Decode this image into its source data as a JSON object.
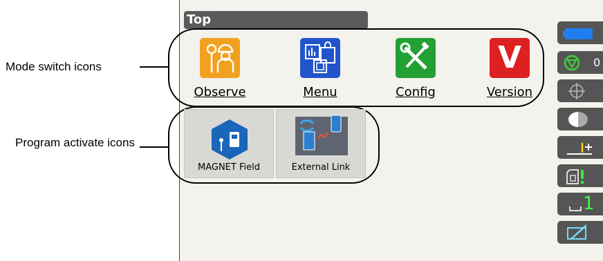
{
  "annotations": {
    "mode_switch": "Mode switch icons",
    "program_activate": "Program activate icons"
  },
  "screen": {
    "title": "Top",
    "mode_icons": [
      {
        "label": "Observe",
        "icon": "surveyor-icon",
        "color": "#f2a020"
      },
      {
        "label": "Menu",
        "icon": "menu-icon",
        "color": "#2255cc"
      },
      {
        "label": "Config",
        "icon": "wrench-screwdriver-icon",
        "color": "#22a033"
      },
      {
        "label": "Version",
        "icon": "version-v-icon",
        "color": "#dd2020",
        "glyph": "V"
      }
    ],
    "program_icons": [
      {
        "label": "MAGNET Field",
        "icon": "magnet-field-icon"
      },
      {
        "label": "External Link",
        "icon": "external-link-icon"
      }
    ],
    "side_buttons": [
      {
        "icon": "battery-icon"
      },
      {
        "icon": "prism-target-icon",
        "partial_text": "0"
      },
      {
        "icon": "crosshair-icon"
      },
      {
        "icon": "half-moon-icon"
      },
      {
        "icon": "plus-offset-icon"
      },
      {
        "icon": "instrument-alert-icon"
      },
      {
        "icon": "one-level-icon",
        "glyph": "1"
      },
      {
        "icon": "pencil-edit-icon"
      }
    ]
  }
}
